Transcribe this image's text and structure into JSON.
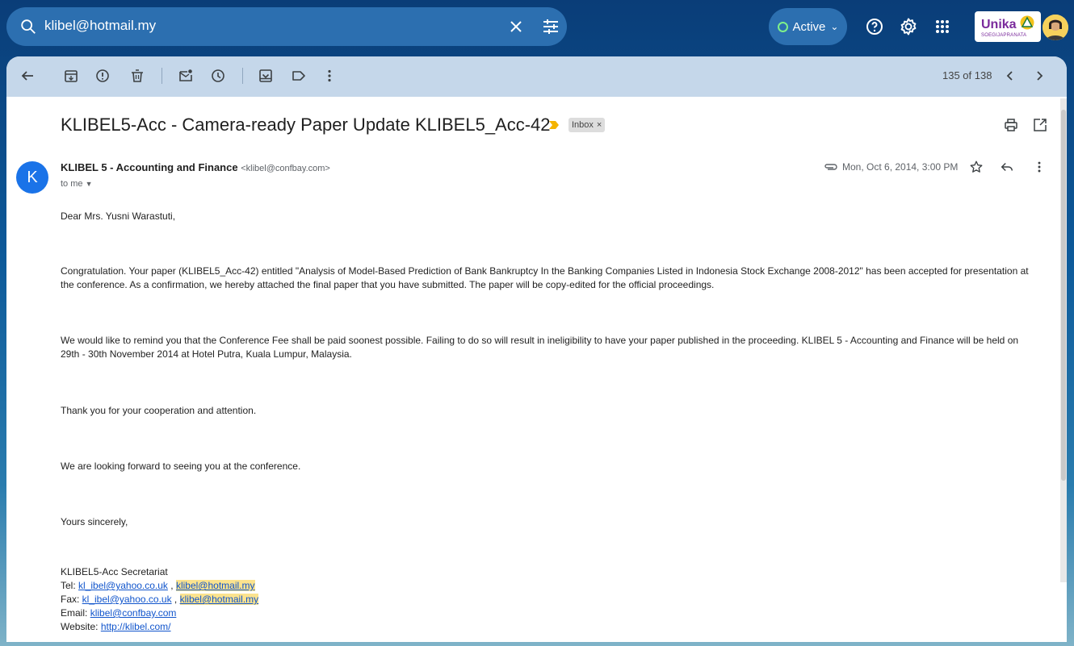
{
  "search": {
    "query": "klibel@hotmail.my"
  },
  "status": {
    "label": "Active"
  },
  "logo": {
    "word": "Unika",
    "sub": "SOEGIJAPRANATA"
  },
  "toolbar": {
    "count": "135 of 138"
  },
  "email": {
    "subject": "KLIBEL5-Acc - Camera-ready Paper Update KLIBEL5_Acc-42",
    "label": "Inbox",
    "label_close": "×",
    "avatar_letter": "K",
    "sender_name": "KLIBEL 5 - Accounting and Finance",
    "sender_addr": "<klibel@confbay.com>",
    "to": "to me",
    "date": "Mon, Oct 6, 2014, 3:00 PM",
    "greeting": "Dear Mrs. Yusni Warastuti,",
    "p1": "Congratulation. Your paper (KLIBEL5_Acc-42) entitled \"Analysis of Model-Based Prediction of Bank Bankruptcy In the Banking Companies Listed in Indonesia Stock Exchange 2008-2012\" has been accepted for presentation at the conference. As a confirmation, we hereby attached the final paper that you have submitted. The paper will be copy-edited for the official proceedings.",
    "p2": "We would like to remind you that the Conference Fee shall be paid soonest possible. Failing to do so will result in ineligibility to have your paper published in the proceeding. KLIBEL 5 - Accounting and Finance will be held on 29th - 30th November 2014 at Hotel Putra, Kuala Lumpur, Malaysia.",
    "p3": "Thank you for your cooperation and attention.",
    "p4": "We are looking forward to seeing you at the conference.",
    "p5": "Yours sincerely,",
    "sig": {
      "org": "KLIBEL5-Acc Secretariat",
      "tel_label": "Tel: ",
      "fax_label": "Fax: ",
      "email_label": "Email: ",
      "web_label": "Website: ",
      "link_yahoo": "kl_ibel@yahoo.co.uk",
      "sep": " , ",
      "link_hotmail": "klibel@hotmail.my",
      "link_confbay": "klibel@confbay.com",
      "link_web": "http://klibel.com/"
    }
  }
}
